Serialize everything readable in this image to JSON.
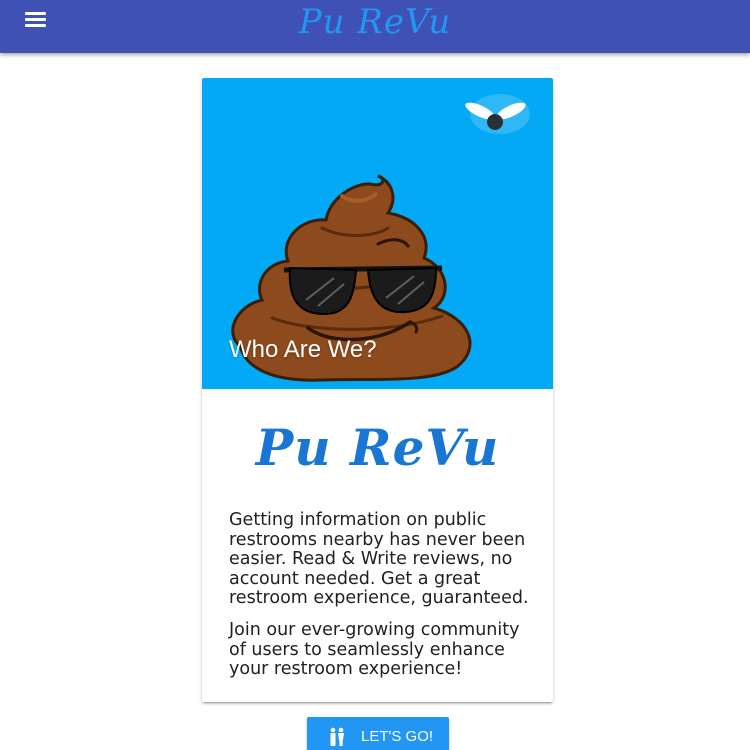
{
  "app": {
    "brand": "Pu ReVu",
    "menu_icon": "hamburger-menu-icon"
  },
  "card": {
    "image_title": "Who Are We?",
    "heading": "Pu ReVu",
    "paragraphs": [
      "Getting information on public restrooms nearby has never been easier. Read & Write reviews, no account needed. Get a great restroom experience, guaranteed.",
      "Join our ever-growing community of users to seamlessly enhance your restroom experience!"
    ]
  },
  "cta": {
    "label": "LET'S GO!",
    "icon": "restroom-people-icon"
  },
  "colors": {
    "navbar": "#3f51b5",
    "brand_text": "#2196f3",
    "card_image_bg": "#03a9f4",
    "heading_text": "#1976d2",
    "button_bg": "#2196f3"
  }
}
